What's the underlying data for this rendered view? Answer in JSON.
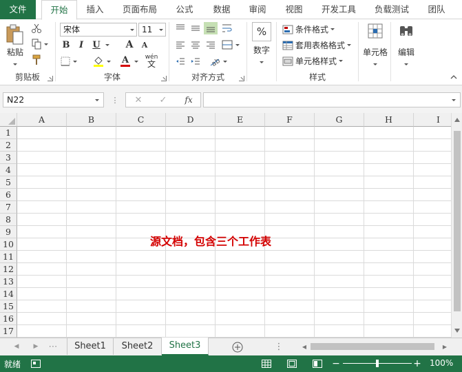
{
  "ribbon_tabs": [
    "文件",
    "开始",
    "插入",
    "页面布局",
    "公式",
    "数据",
    "审阅",
    "视图",
    "开发工具",
    "负载测试",
    "团队"
  ],
  "clipboard": {
    "paste_label": "粘贴",
    "group_label": "剪贴板"
  },
  "font": {
    "name": "宋体",
    "size": "11",
    "group_label": "字体",
    "bold": "B",
    "italic": "I",
    "underline": "U",
    "grow": "A",
    "shrink": "A",
    "font_color": "A",
    "phonetic": "wén",
    "phonetic_sub": "文"
  },
  "alignment": {
    "group_label": "对齐方式"
  },
  "number": {
    "label": "数字",
    "icon": "%"
  },
  "styles": {
    "group_label": "样式",
    "conditional": "条件格式",
    "table_format": "套用表格格式",
    "cell_styles": "单元格样式"
  },
  "cells": {
    "label": "单元格"
  },
  "editing": {
    "label": "编辑"
  },
  "formula_bar": {
    "name_box": "N22",
    "fx": "fx",
    "cancel": "✕",
    "enter": "✓",
    "value": ""
  },
  "columns": [
    "A",
    "B",
    "C",
    "D",
    "E",
    "F",
    "G",
    "H",
    "I"
  ],
  "rows": [
    "1",
    "2",
    "3",
    "4",
    "5",
    "6",
    "7",
    "8",
    "9",
    "10",
    "11",
    "12",
    "13",
    "14",
    "15",
    "16",
    "17"
  ],
  "annotation_text": "源文档，包含三个工作表",
  "sheets": [
    "Sheet1",
    "Sheet2",
    "Sheet3"
  ],
  "active_sheet": "Sheet3",
  "status": {
    "mode": "就绪",
    "zoom": "100%"
  },
  "colors": {
    "accent": "#217346",
    "annotation": "#d40000"
  }
}
